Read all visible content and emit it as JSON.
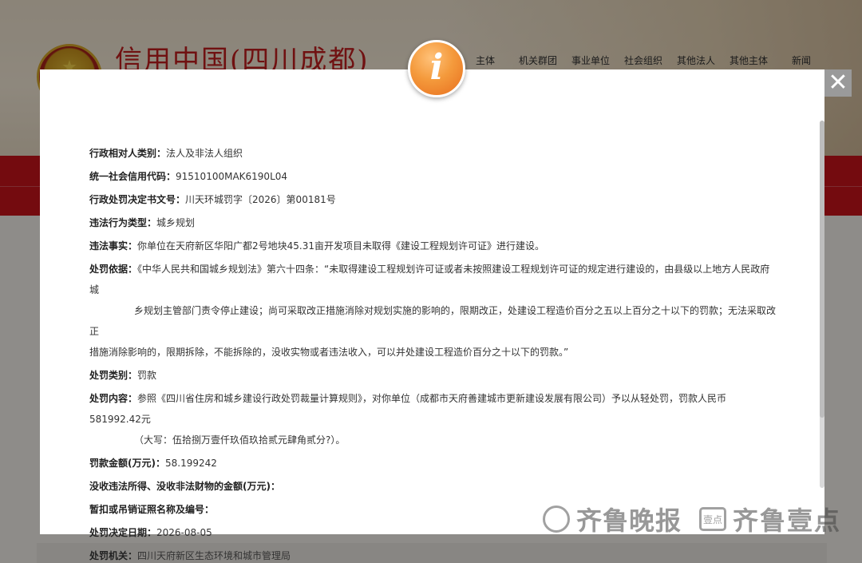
{
  "background": {
    "site_title": "信用中国(四川成都)",
    "nav_items": [
      "主体",
      "机关群团",
      "事业单位",
      "社会组织",
      "其他法人",
      "其他主体",
      "新闻"
    ]
  },
  "modal": {
    "badge_glyph": "i",
    "close_glyph": "✕",
    "fields": {
      "party_type": {
        "label": "行政相对人类别：",
        "value": "法人及非法人组织"
      },
      "credit_code": {
        "label": "统一社会信用代码：",
        "value": "91510100MAK6190L04"
      },
      "decision_no": {
        "label": "行政处罚决定书文号：",
        "value": "川天环城罚字〔2026〕第00181号"
      },
      "violation_type": {
        "label": "违法行为类型：",
        "value": "城乡规划"
      },
      "violation_facts": {
        "label": "违法事实：",
        "value": "你单位在天府新区华阳广都2号地块45.31亩开发项目未取得《建设工程规划许可证》进行建设。"
      },
      "basis": {
        "label": "处罚依据：",
        "lines": [
          "《中华人民共和国城乡规划法》第六十四条：“未取得建设工程规划许可证或者未按照建设工程规划许可证的规定进行建设的，由县级以上地方人民政府城",
          "乡规划主管部门责令停止建设；尚可采取改正措施消除对规划实施的影响的，限期改正，处建设工程造价百分之五以上百分之十以下的罚款；无法采取改正",
          "措施消除影响的，限期拆除，不能拆除的，没收实物或者违法收入，可以并处建设工程造价百分之十以下的罚款。”"
        ]
      },
      "penalty_type": {
        "label": "处罚类别：",
        "value": "罚款"
      },
      "penalty_content": {
        "label": "处罚内容：",
        "lines": [
          "参照《四川省住房和城乡建设行政处罚裁量计算规则》，对你单位（成都市天府善建城市更新建设发展有限公司）予以从轻处罚，罚款人民币581992.42元",
          "（大写：伍拾捌万壹仟玖佰玖拾贰元肆角贰分?）。"
        ]
      },
      "fine_amount": {
        "label": "罚款金额(万元)：",
        "value": "58.199242"
      },
      "confiscation": {
        "label": "没收违法所得、没收非法财物的金额(万元)：",
        "value": ""
      },
      "license_suspension": {
        "label": "暂扣或吊销证照名称及编号：",
        "value": ""
      },
      "decision_date": {
        "label": "处罚决定日期：",
        "value": "2026-08-05"
      },
      "authority": {
        "label": "处罚机关：",
        "value": "四川天府新区生态环境和城市管理局"
      }
    }
  },
  "watermark": {
    "brand1": "齐鲁晚报",
    "box_text": "壹点",
    "brand2": "齐鲁壹点"
  }
}
